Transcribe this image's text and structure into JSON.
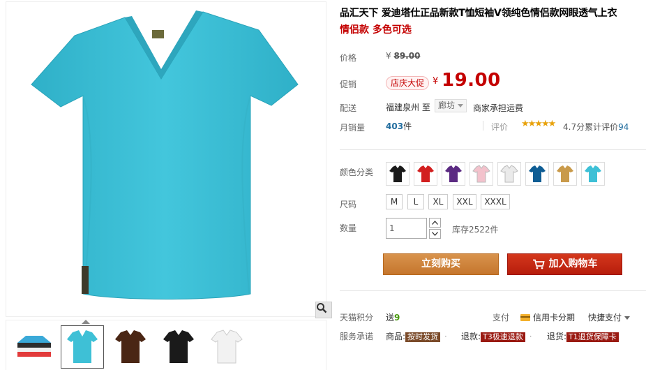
{
  "product": {
    "title": "品汇天下 爱迪塔仕正品新款T恤短袖V领纯色情侣款网眼透气上衣",
    "subtitle": "情侣款 多色可选"
  },
  "labels": {
    "price": "价格",
    "promo": "促销",
    "shipping": "配送",
    "monthly_sales": "月销量",
    "review": "评价",
    "color": "颜色分类",
    "size": "尺码",
    "quantity": "数量",
    "points": "天猫积分",
    "pay": "支付",
    "service": "服务承诺"
  },
  "price": {
    "currency": "¥",
    "original": "89.00",
    "promo_badge": "店庆大促",
    "promo": "19.00"
  },
  "shipping": {
    "from": "福建泉州",
    "to_word": "至",
    "to": "廊坊",
    "fee": "商家承担运费"
  },
  "sales": {
    "count": "403",
    "unit": "件"
  },
  "rating": {
    "stars": "★★★★★",
    "score_text": "4.7分累计评价",
    "count": "94"
  },
  "colors": [
    {
      "name": "black",
      "hex": "#1a1a1a"
    },
    {
      "name": "red",
      "hex": "#d21f1f"
    },
    {
      "name": "purple",
      "hex": "#5b2a82"
    },
    {
      "name": "pink",
      "hex": "#f3c2cc"
    },
    {
      "name": "white",
      "hex": "#eaeaea"
    },
    {
      "name": "royal-blue",
      "hex": "#0f5d94"
    },
    {
      "name": "khaki",
      "hex": "#c99a4a"
    },
    {
      "name": "sky-blue",
      "hex": "#3ec0d6"
    }
  ],
  "sizes": [
    "M",
    "L",
    "XL",
    "XXL",
    "XXXL"
  ],
  "quantity": {
    "value": "1",
    "stock": "库存2522件"
  },
  "buttons": {
    "buy_now": "立刻购买",
    "add_cart": "加入购物车"
  },
  "points": {
    "prefix": "送",
    "value": "9"
  },
  "payment": {
    "card": "信用卡分期",
    "quick": "快捷支付"
  },
  "services": [
    {
      "prefix": "商品:",
      "tag": "按时发货"
    },
    {
      "prefix": "退款:",
      "tag": "T3极速退款"
    },
    {
      "prefix": "退货:",
      "tag": "T1退货保障卡"
    }
  ],
  "thumbnails": [
    {
      "name": "folded-stack",
      "hex": "#3aa9d8"
    },
    {
      "name": "sky-blue",
      "hex": "#3ec0d6"
    },
    {
      "name": "brown",
      "hex": "#4a2614"
    },
    {
      "name": "black",
      "hex": "#1a1a1a"
    },
    {
      "name": "white",
      "hex": "#f2f2f2"
    }
  ],
  "colors_theme": {
    "accent_red": "#c40000",
    "buy_orange": "#c5762d",
    "tee_main": "#3ec0d6"
  }
}
